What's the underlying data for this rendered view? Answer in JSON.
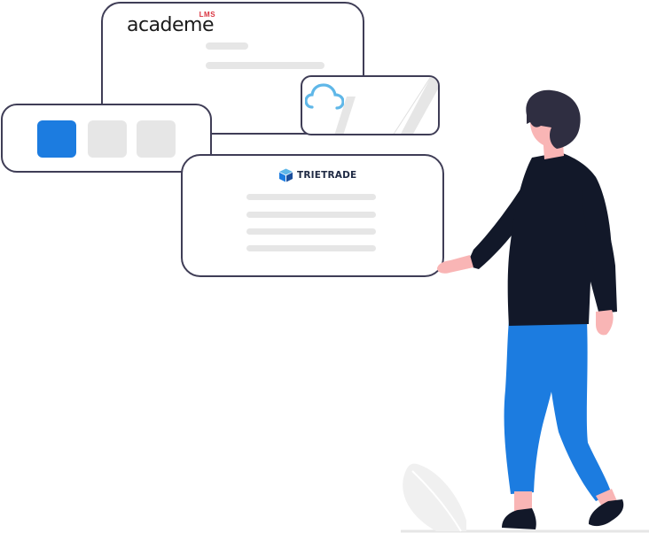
{
  "academe_card": {
    "logo_text": "academe",
    "logo_superscript": "LMS"
  },
  "tiles_card": {
    "tiles": [
      {
        "state": "active"
      },
      {
        "state": "inactive"
      },
      {
        "state": "inactive"
      }
    ]
  },
  "cloud_card": {
    "icon": "cloud-icon"
  },
  "trietrade_card": {
    "logo_text": "TRIETRADE",
    "icon": "cube-logo-icon"
  },
  "colors": {
    "accent_blue": "#1c7ce0",
    "outline": "#3f3d56",
    "placeholder_gray": "#e6e6e6",
    "shirt": "#121829",
    "hair": "#2f2e41",
    "skin": "#f9b5b5",
    "logo_red": "#d9333f",
    "cloud_blue": "#5fb7e8"
  }
}
